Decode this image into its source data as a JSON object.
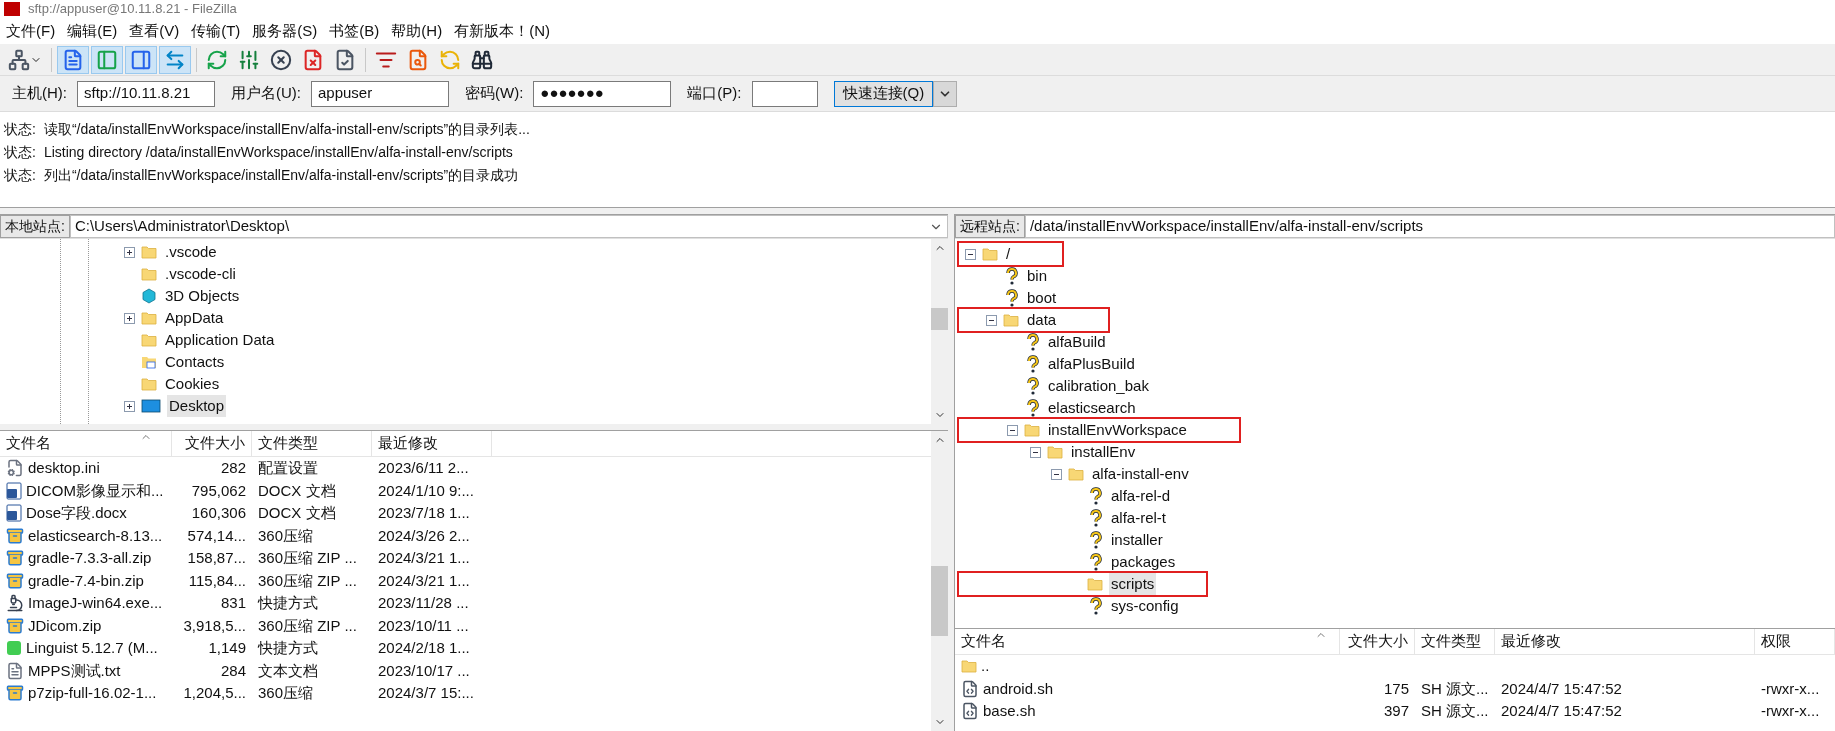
{
  "window": {
    "title": "sftp://appuser@10.11.8.21 - FileZilla"
  },
  "menu": [
    "文件(F)",
    "编辑(E)",
    "查看(V)",
    "传输(T)",
    "服务器(S)",
    "书签(B)",
    "帮助(H)",
    "有新版本！(N)"
  ],
  "toolbar": [
    {
      "kind": "site-manager"
    },
    {
      "kind": "log",
      "selected": true
    },
    {
      "kind": "local-tree",
      "selected": true
    },
    {
      "kind": "remote-tree",
      "selected": true
    },
    {
      "kind": "queue",
      "selected": true
    },
    {
      "kind": "refresh"
    },
    {
      "kind": "process"
    },
    {
      "kind": "cancel"
    },
    {
      "kind": "disconnect"
    },
    {
      "kind": "reconnect"
    },
    {
      "kind": "filter"
    },
    {
      "kind": "compare"
    },
    {
      "kind": "sync"
    },
    {
      "kind": "find"
    }
  ],
  "quickconnect": {
    "fields": [
      {
        "label": "主机(H):",
        "value": "sftp://10.11.8.21"
      },
      {
        "label": "用户名(U):",
        "value": "appuser"
      },
      {
        "label": "密码(W):",
        "value": "●●●●●●●"
      },
      {
        "label": "端口(P):"
      }
    ],
    "button": "快速连接(Q)"
  },
  "log": [
    {
      "label": "状态:",
      "message": "读取“/data/installEnvWorkspace/installEnv/alfa-install-env/scripts”的目录列表..."
    },
    {
      "label": "状态:",
      "message": "Listing directory /data/installEnvWorkspace/installEnv/alfa-install-env/scripts"
    },
    {
      "label": "状态:",
      "message": "列出“/data/installEnvWorkspace/installEnv/alfa-install-env/scripts”的目录成功"
    }
  ],
  "local_site": {
    "label": "本地站点:",
    "path": "C:\\Users\\Administrator\\Desktop\\",
    "tree": [
      {
        "name": ".vscode",
        "kind": "folder",
        "expanded": false,
        "selected": false
      },
      {
        "name": ".vscode-cli",
        "kind": "folder",
        "selected": false
      },
      {
        "name": "3D Objects",
        "kind": "cube",
        "selected": false
      },
      {
        "name": "AppData",
        "kind": "folder",
        "expanded": false,
        "selected": false
      },
      {
        "name": "Application Data",
        "kind": "folder",
        "selected": false
      },
      {
        "name": "Contacts",
        "kind": "contacts",
        "selected": false
      },
      {
        "name": "Cookies",
        "kind": "folder",
        "selected": false
      },
      {
        "name": "Desktop",
        "kind": "desktop",
        "expanded": false,
        "selected": true
      }
    ],
    "columns": [
      "文件名",
      "文件大小",
      "文件类型",
      "最近修改"
    ],
    "files": [
      {
        "kind": "settings",
        "name": "desktop.ini",
        "size": "282",
        "type": "配置设置",
        "modified": "2023/6/11 2..."
      },
      {
        "kind": "word",
        "name": "DICOM影像显示和...",
        "size": "795,062",
        "type": "DOCX 文档",
        "modified": "2024/1/10 9:..."
      },
      {
        "kind": "word",
        "name": "Dose字段.docx",
        "size": "160,306",
        "type": "DOCX 文档",
        "modified": "2023/7/18 1..."
      },
      {
        "kind": "archive",
        "name": "elasticsearch-8.13...",
        "size": "574,14...",
        "type": "360压缩",
        "modified": "2024/3/26 2..."
      },
      {
        "kind": "archive",
        "name": "gradle-7.3.3-all.zip",
        "size": "158,87...",
        "type": "360压缩 ZIP ...",
        "modified": "2024/3/21 1..."
      },
      {
        "kind": "archive",
        "name": "gradle-7.4-bin.zip",
        "size": "115,84...",
        "type": "360压缩 ZIP ...",
        "modified": "2024/3/21 1..."
      },
      {
        "kind": "microscope",
        "name": "ImageJ-win64.exe...",
        "size": "831",
        "type": "快捷方式",
        "modified": "2023/11/28 ..."
      },
      {
        "kind": "archive",
        "name": "JDicom.zip",
        "size": "3,918,5...",
        "type": "360压缩 ZIP ...",
        "modified": "2023/10/11 ..."
      },
      {
        "kind": "qt",
        "name": "Linguist 5.12.7 (M...",
        "size": "1,149",
        "type": "快捷方式",
        "modified": "2024/2/18 1..."
      },
      {
        "kind": "text",
        "name": "MPPS测试.txt",
        "size": "284",
        "type": "文本文档",
        "modified": "2023/10/17 ..."
      },
      {
        "kind": "archive",
        "name": "p7zip-full-16.02-1...",
        "size": "1,204,5...",
        "type": "360压缩",
        "modified": "2024/3/7 15:..."
      }
    ]
  },
  "remote_site": {
    "label": "远程站点:",
    "path": "/data/installEnvWorkspace/installEnv/alfa-install-env/scripts",
    "tree": [
      {
        "name": "/",
        "kind": "folder",
        "expanded": true,
        "selected": false,
        "highlighted": true,
        "children": [
          {
            "name": "bin",
            "kind": "unknown",
            "selected": false,
            "highlighted": false
          },
          {
            "name": "boot",
            "kind": "unknown",
            "selected": false,
            "highlighted": false
          },
          {
            "name": "data",
            "kind": "folder",
            "expanded": true,
            "selected": false,
            "highlighted": true,
            "children": [
              {
                "name": "alfaBuild",
                "kind": "unknown",
                "selected": false,
                "highlighted": false
              },
              {
                "name": "alfaPlusBuild",
                "kind": "unknown",
                "selected": false,
                "highlighted": false
              },
              {
                "name": "calibration_bak",
                "kind": "unknown",
                "selected": false,
                "highlighted": false
              },
              {
                "name": "elasticsearch",
                "kind": "unknown",
                "selected": false,
                "highlighted": false
              },
              {
                "name": "installEnvWorkspace",
                "kind": "folder",
                "expanded": true,
                "selected": false,
                "highlighted": true,
                "children": [
                  {
                    "name": "installEnv",
                    "kind": "folder",
                    "expanded": true,
                    "selected": false,
                    "highlighted": false,
                    "children": [
                      {
                        "name": "alfa-install-env",
                        "kind": "folder",
                        "expanded": true,
                        "selected": false,
                        "highlighted": false,
                        "children": [
                          {
                            "name": "alfa-rel-d",
                            "kind": "unknown",
                            "selected": false,
                            "highlighted": false
                          },
                          {
                            "name": "alfa-rel-t",
                            "kind": "unknown",
                            "selected": false,
                            "highlighted": false
                          },
                          {
                            "name": "installer",
                            "kind": "unknown",
                            "selected": false,
                            "highlighted": false
                          },
                          {
                            "name": "packages",
                            "kind": "unknown",
                            "selected": false,
                            "highlighted": false
                          },
                          {
                            "name": "scripts",
                            "kind": "folder",
                            "selected": true,
                            "highlighted": true
                          },
                          {
                            "name": "sys-config",
                            "kind": "unknown",
                            "selected": false,
                            "highlighted": false
                          }
                        ]
                      }
                    ]
                  }
                ]
              }
            ]
          }
        ]
      }
    ],
    "columns": [
      "文件名",
      "文件大小",
      "文件类型",
      "最近修改",
      "权限"
    ],
    "files": [
      {
        "kind": "folder",
        "name": ".."
      },
      {
        "kind": "script",
        "name": "android.sh",
        "size": "175",
        "type": "SH 源文...",
        "modified": "2024/4/7 15:47:52",
        "permissions": "-rwxr-x..."
      },
      {
        "kind": "script",
        "name": "base.sh",
        "size": "397",
        "type": "SH 源文...",
        "modified": "2024/4/7 15:47:52",
        "permissions": "-rwxr-x..."
      }
    ]
  }
}
